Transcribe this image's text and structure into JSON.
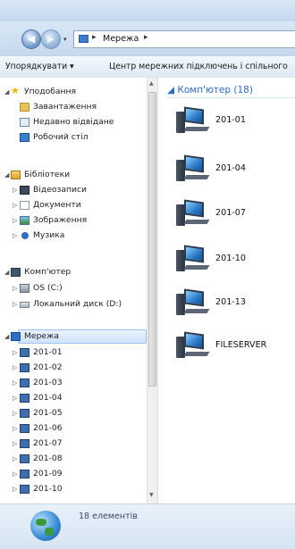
{
  "address": {
    "location": "Мережа",
    "separator": "▸"
  },
  "toolbar": {
    "organize_label": "Упорядкувати ▾",
    "network_center_label": "Центр мережних підключень і спільного"
  },
  "nav": {
    "favorites": {
      "label": "Уподобання",
      "items": [
        "Завантаження",
        "Недавно відвідане",
        "Робочий стіл"
      ]
    },
    "libraries": {
      "label": "Бібліотеки",
      "items": [
        "Відеозаписи",
        "Документи",
        "Зображення",
        "Музика"
      ]
    },
    "computer": {
      "label": "Комп'ютер",
      "items": [
        "OS (C:)",
        "Локальний диск (D:)"
      ]
    },
    "network": {
      "label": "Мережа",
      "items": [
        "201-01",
        "201-02",
        "201-03",
        "201-04",
        "201-05",
        "201-06",
        "201-07",
        "201-08",
        "201-09",
        "201-10"
      ]
    }
  },
  "content": {
    "group_header": "Комп'ютер (18)",
    "items": [
      "201-01",
      "201-04",
      "201-07",
      "201-10",
      "201-13",
      "FILESERVER"
    ]
  },
  "status": {
    "count_text": "18 елементів"
  },
  "icons": {
    "back": "back-arrow-icon",
    "forward": "forward-arrow-icon",
    "network": "network-icon",
    "computer": "computer-icon",
    "globe": "network-globe-icon"
  },
  "colors": {
    "group_header": "#2e6cbf",
    "selection": "#cfe3fa",
    "window_chrome": "#c6d9ee"
  }
}
